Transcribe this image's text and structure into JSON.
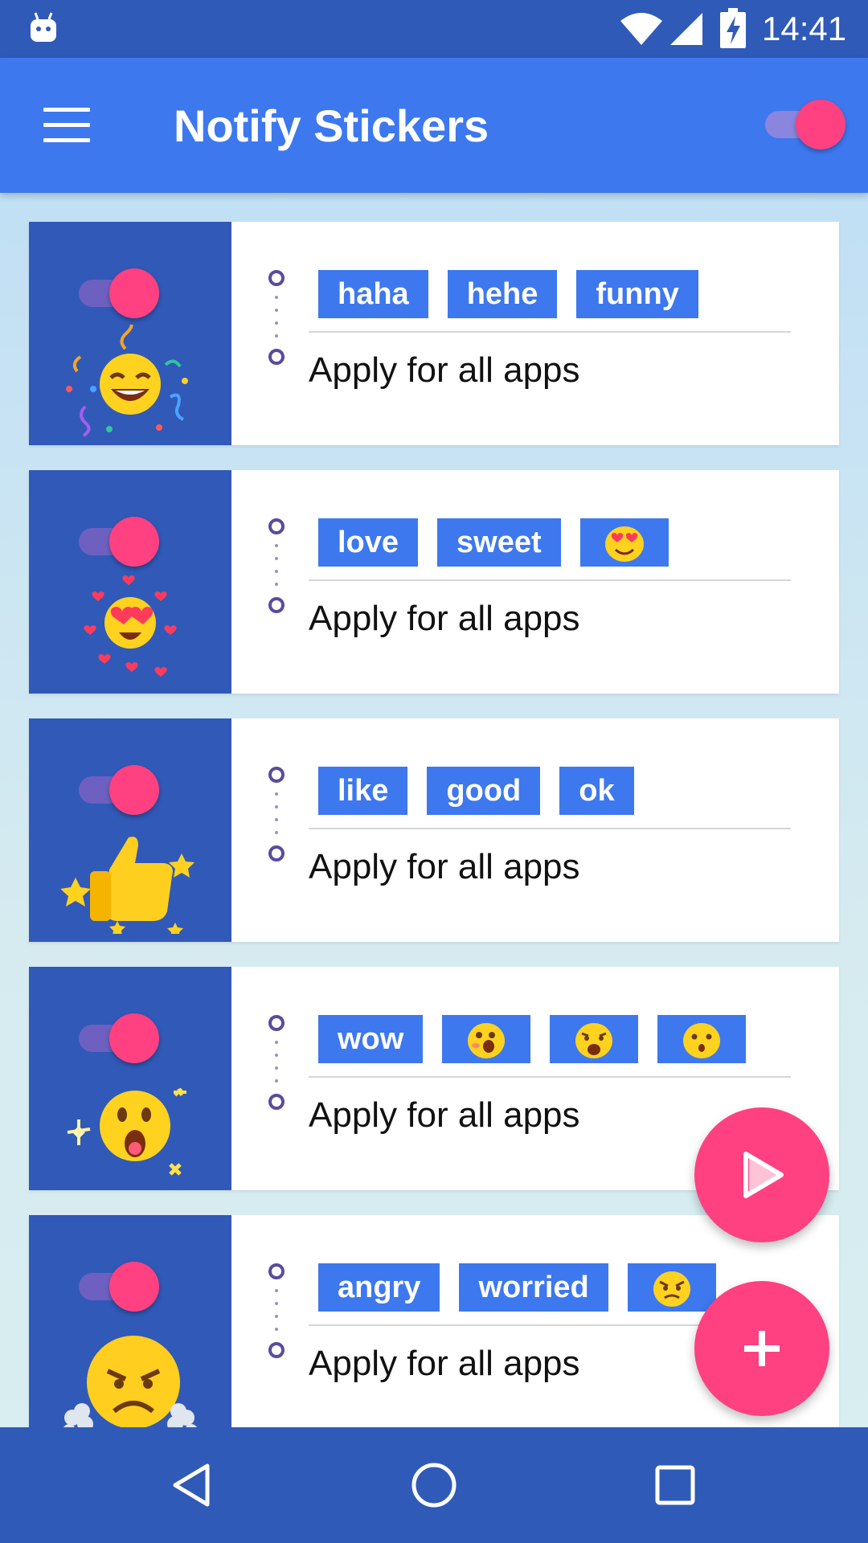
{
  "status_bar": {
    "time": "14:41"
  },
  "app_bar": {
    "title": "Notify Stickers",
    "master_toggle_on": true
  },
  "cards": [
    {
      "toggle_on": true,
      "sticker": "laughing-party-emoji",
      "tags": [
        "haha",
        "hehe",
        "funny"
      ],
      "apply_label": "Apply for all apps"
    },
    {
      "toggle_on": true,
      "sticker": "heart-eyes-emoji",
      "tags": [
        "love",
        "sweet",
        "heart-eyes-emoji"
      ],
      "apply_label": "Apply for all apps"
    },
    {
      "toggle_on": true,
      "sticker": "thumbs-up-emoji",
      "tags": [
        "like",
        "good",
        "ok"
      ],
      "apply_label": "Apply for all apps"
    },
    {
      "toggle_on": true,
      "sticker": "shocked-face-emoji",
      "tags": [
        "wow",
        "surprised-emoji",
        "shocked-emoji",
        "hushed-emoji"
      ],
      "apply_label": "Apply for all apps"
    },
    {
      "toggle_on": true,
      "sticker": "angry-steam-emoji",
      "tags": [
        "angry",
        "worried",
        "angry-face-emoji"
      ],
      "apply_label": "Apply for all apps"
    }
  ],
  "fabs": {
    "play": "play-icon",
    "add": "plus-icon"
  },
  "colors": {
    "primary": "#3d78ef",
    "primary_dark": "#2f5ab8",
    "accent": "#ff4081",
    "thumb_bg": "#3159b8"
  }
}
